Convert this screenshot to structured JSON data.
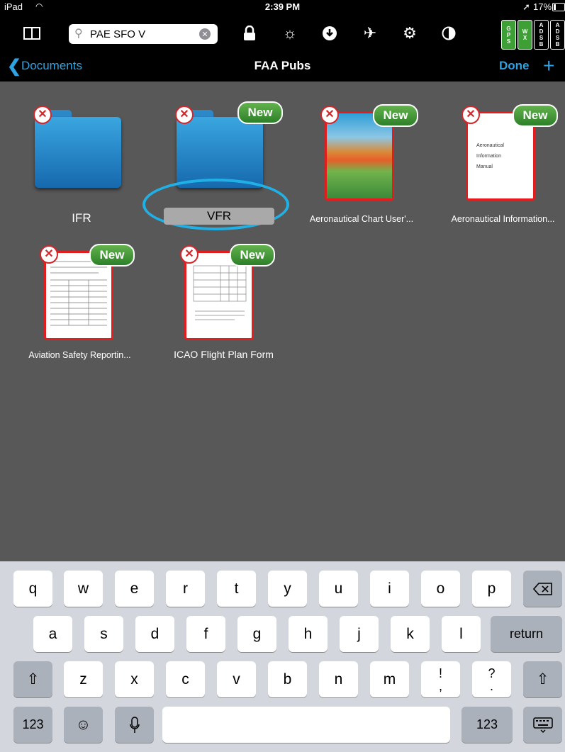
{
  "status_bar": {
    "device": "iPad",
    "time": "2:39 PM",
    "battery": "17%"
  },
  "toolbar": {
    "search_value": "PAE SFO V",
    "icons": [
      "split-view-icon",
      "lock-icon",
      "brightness-icon",
      "download-icon",
      "airplane-icon",
      "gear-icon",
      "contrast-icon"
    ],
    "badges": [
      {
        "lines": [
          "G",
          "P",
          "S"
        ],
        "color": "#3f9f37"
      },
      {
        "lines": [
          "W",
          "X"
        ],
        "color": "#3f9f37"
      },
      {
        "lines": [
          "A",
          "D",
          "S",
          "B"
        ],
        "color": "#000000"
      },
      {
        "lines": [
          "A",
          "D",
          "S",
          "B"
        ],
        "color": "#000000"
      }
    ]
  },
  "nav": {
    "back_label": "Documents",
    "title": "FAA Pubs",
    "done_label": "Done",
    "add_label": "+"
  },
  "items": [
    {
      "label": "IFR",
      "kind": "folder",
      "new": false
    },
    {
      "label": "VFR",
      "kind": "folder",
      "new": true,
      "editing": true
    },
    {
      "label": "Aeronautical Chart User'...",
      "kind": "doc",
      "new": true
    },
    {
      "label": "Aeronautical Information...",
      "kind": "doc",
      "new": true
    },
    {
      "label": "Aviation Safety Reportin...",
      "kind": "doc",
      "new": true
    },
    {
      "label": "ICAO Flight Plan Form",
      "kind": "doc",
      "new": true
    }
  ],
  "new_badge_label": "New",
  "doc_thumb_text": {
    "aim_lines": [
      "Aeronautical",
      "Information",
      "Manual"
    ]
  },
  "keyboard": {
    "row1": [
      "q",
      "w",
      "e",
      "r",
      "t",
      "y",
      "u",
      "i",
      "o",
      "p"
    ],
    "row2": [
      "a",
      "s",
      "d",
      "f",
      "g",
      "h",
      "j",
      "k",
      "l"
    ],
    "row3": [
      "z",
      "x",
      "c",
      "v",
      "b",
      "n",
      "m"
    ],
    "row3_punct": [
      [
        "!",
        ","
      ],
      [
        "?",
        "."
      ]
    ],
    "return_label": "return",
    "numbers_label": "123"
  },
  "colors": {
    "accent": "#2ea3e3",
    "highlight": "#1fb1e6",
    "delete": "#d6252a",
    "new_badge": "#3f9f37",
    "content_bg": "#585858"
  }
}
